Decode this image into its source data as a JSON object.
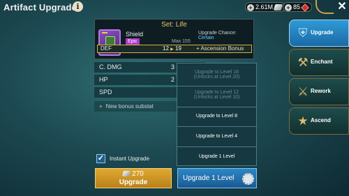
{
  "header": {
    "title": "Artifact Upgrade",
    "info_icon": "i",
    "silver_amount": "2.61M",
    "gems_amount": "85",
    "close_icon": "✕"
  },
  "artifact": {
    "set_label": "Set: Life",
    "name": "Shield",
    "rarity": "Epic",
    "rarity_color": "#b03ac8",
    "upgrade_chance_label": "Upgrade Chance:",
    "upgrade_chance_value": "Certain",
    "max_label": "Max 155",
    "main_stat": {
      "label": "DEF",
      "from": "12",
      "arrow": "▶",
      "to": "19",
      "bonus": "+ Ascension Bonus"
    }
  },
  "substats": [
    {
      "label": "C. DMG",
      "value": "3"
    },
    {
      "label": "HP",
      "value": "2"
    },
    {
      "label": "SPD",
      "value": ""
    }
  ],
  "new_substat": {
    "icon": "+",
    "label": "New bonus substat"
  },
  "dropdown": {
    "items": [
      {
        "line1": "Upgrade to Level 16",
        "line2": "(Unlocks at Level 20)",
        "enabled": false
      },
      {
        "line1": "Upgrade to Level 12",
        "line2": "(Unlocks at Level 10)",
        "enabled": false
      },
      {
        "line1": "Upgrade to Level 8",
        "enabled": true
      },
      {
        "line1": "Upgrade to Level 4",
        "enabled": true
      },
      {
        "line1": "Upgrade 1 Level",
        "enabled": true
      }
    ]
  },
  "instant_upgrade": {
    "label": "Instant Upgrade",
    "checked": true,
    "check_mark": "✓"
  },
  "upgrade_button": {
    "cost": "270",
    "label": "Upgrade"
  },
  "level_button": {
    "label": "Upgrade 1 Level"
  },
  "side_tabs": [
    {
      "label": "Upgrade",
      "icon": "armor-icon",
      "active": true
    },
    {
      "label": "Enchant",
      "icon": "anvil-icon",
      "active": false
    },
    {
      "label": "Rework",
      "icon": "hammer-wrench-icon",
      "active": false
    },
    {
      "label": "Ascend",
      "icon": "star-helmet-icon",
      "active": false
    }
  ]
}
